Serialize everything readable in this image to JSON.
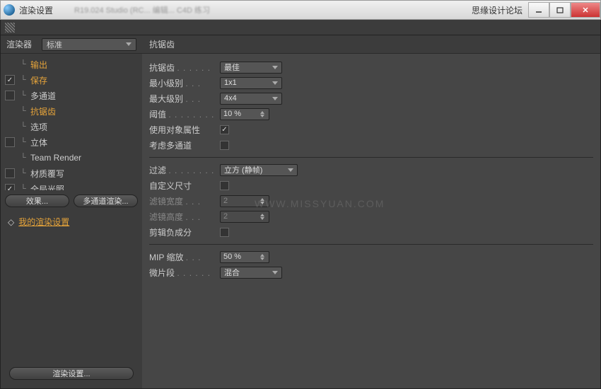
{
  "titlebar": {
    "title": "渲染设置",
    "blur_text": "R19.024 Studio (RC... 编辑... C4D 练习",
    "forum": "思缘设计论坛"
  },
  "watermark": "WWW.MISSYUAN.COM",
  "left": {
    "renderer_label": "渲染器",
    "renderer_value": "标准",
    "tree": [
      {
        "checked": false,
        "hide_cb": true,
        "label": "输出",
        "orange": true
      },
      {
        "checked": true,
        "label": "保存",
        "orange": true
      },
      {
        "checked": false,
        "label": "多通道"
      },
      {
        "checked": false,
        "hide_cb": true,
        "label": "抗锯齿",
        "orange": true,
        "selected": true
      },
      {
        "checked": false,
        "hide_cb": true,
        "label": "选项"
      },
      {
        "checked": false,
        "label": "立体"
      },
      {
        "checked": false,
        "hide_cb": true,
        "label": "Team Render"
      },
      {
        "checked": false,
        "label": "材质覆写"
      },
      {
        "checked": true,
        "label": "全局光照"
      }
    ],
    "effects_btn": "效果...",
    "multi_btn": "多通道渲染...",
    "presets_label": "我的渲染设置",
    "bottom_btn": "渲染设置..."
  },
  "right": {
    "header": "抗锯齿",
    "aa_label": "抗锯齿",
    "aa_value": "最佳",
    "min_label": "最小级别",
    "min_value": "1x1",
    "max_label": "最大级别",
    "max_value": "4x4",
    "threshold_label": "阈值",
    "threshold_value": "10 %",
    "use_obj_label": "使用对象属性",
    "consider_label": "考虑多通道",
    "filter_label": "过滤",
    "filter_value": "立方 (静帧)",
    "custom_label": "自定义尺寸",
    "fw_label": "滤镜宽度",
    "fw_value": "2",
    "fh_label": "滤镜高度",
    "fh_value": "2",
    "neg_label": "剪辑负成分",
    "mip_label": "MIP 缩放",
    "mip_value": "50 %",
    "micro_label": "微片段",
    "micro_value": "混合"
  }
}
